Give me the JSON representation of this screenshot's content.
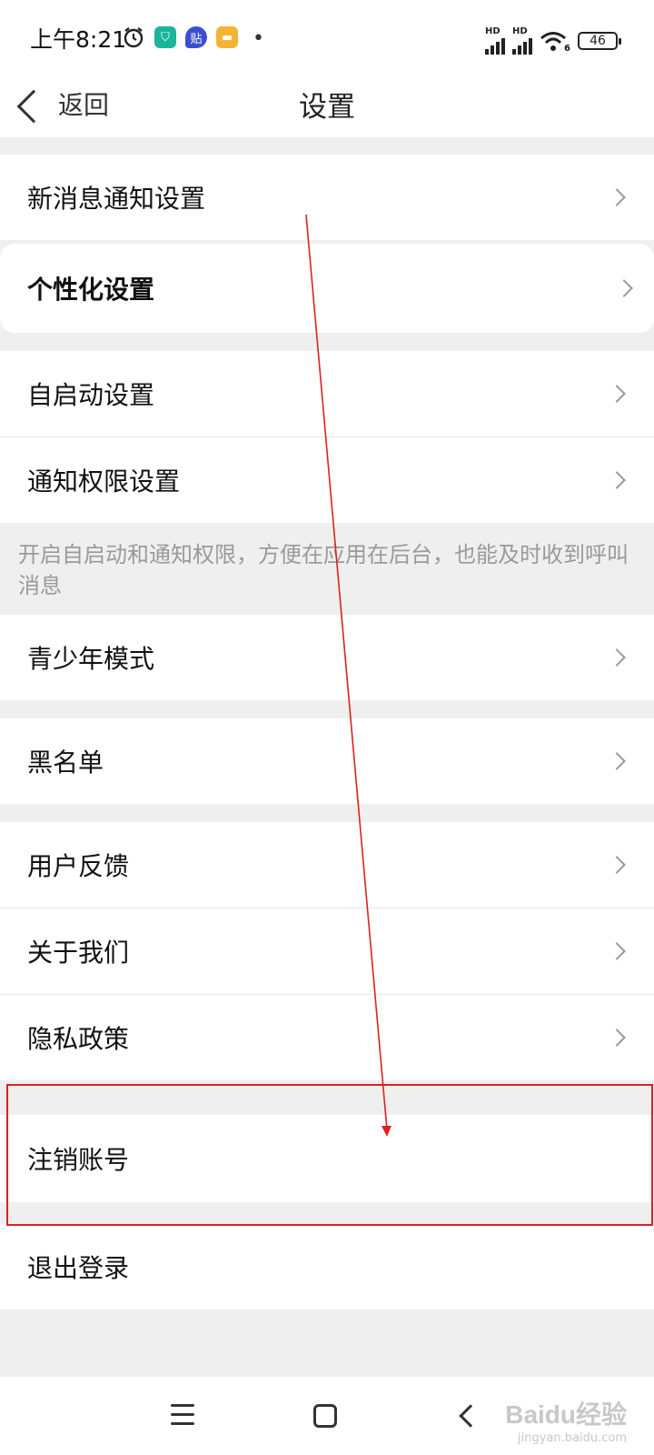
{
  "status_bar": {
    "time": "上午8:21",
    "app_icons": [
      "alarm-icon",
      "shield-app-icon",
      "tieba-app-icon",
      "note-app-icon"
    ],
    "app_icon_colors": [
      "#1bb59b",
      "#3a4fd0",
      "#f5b335"
    ],
    "tieba_glyph": "贴",
    "hd_label": "HD",
    "wifi_sub": "6",
    "battery_level": "46"
  },
  "nav": {
    "back_label": "返回",
    "title": "设置"
  },
  "items": {
    "new_message_notify": "新消息通知设置",
    "personalization": "个性化设置",
    "auto_start": "自启动设置",
    "notify_permission": "通知权限设置",
    "hint": "开启自启动和通知权限，方便在应用在后台，也能及时收到呼叫消息",
    "youth_mode": "青少年模式",
    "blacklist": "黑名单",
    "feedback": "用户反馈",
    "about_us": "关于我们",
    "privacy_policy": "隐私政策",
    "cancel_account": "注销账号",
    "logout": "退出登录"
  },
  "annotation_color": "#e02020",
  "watermark": {
    "main": "Baidu经验",
    "sub": "jingyan.baidu.com"
  }
}
